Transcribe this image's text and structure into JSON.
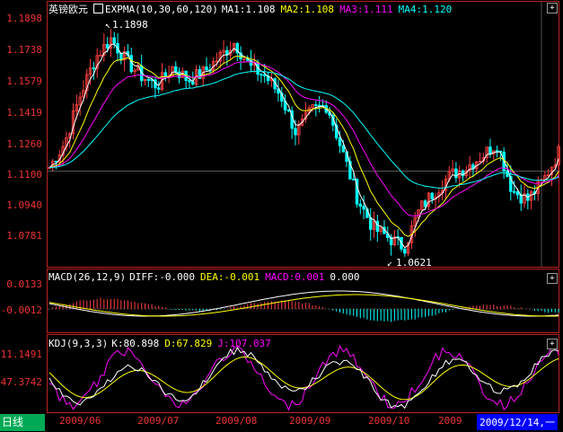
{
  "main": {
    "title": "英镑欧元",
    "indicator": "EXPMA(10,30,60,120)",
    "ma1": "MA1:1.108",
    "ma2": "MA2:1.108",
    "ma3": "MA3:1.111",
    "ma4": "MA4:1.120",
    "y_labels": [
      "1.1898",
      "1.1738",
      "1.1579",
      "1.1419",
      "1.1260",
      "1.1100",
      "1.0940",
      "1.0781"
    ],
    "high_label": "1.1898",
    "low_label": "1.0621"
  },
  "macd": {
    "title": "MACD(26,12,9)",
    "diff": "DIFF:-0.000",
    "dea": "DEA:-0.001",
    "macd": "MACD:0.001",
    "extra": "0.000",
    "y_labels": [
      "0.0133",
      "-0.0012"
    ]
  },
  "kdj": {
    "title": "KDJ(9,3,3)",
    "k": "K:80.898",
    "d": "D:67.829",
    "j": "J:107.037",
    "y_labels": [
      "11.1491",
      "47.3742"
    ]
  },
  "footer": {
    "period": "日线",
    "x_labels": [
      "2009/06",
      "2009/07",
      "2009/08",
      "2009/09",
      "2009/10",
      "2009"
    ],
    "current_date": "2009/12/14,一"
  },
  "buttons": {
    "plus": "+"
  },
  "colors": {
    "up": "#ff4040",
    "down": "#00ffff",
    "ma1": "#ffffff",
    "ma2": "#ffff00",
    "ma3": "#ff00ff",
    "ma4": "#00ffff",
    "axis": "#b22222"
  },
  "chart_data": [
    {
      "type": "candlestick",
      "title": "英镑欧元",
      "ylim": [
        1.0621,
        1.1898
      ],
      "x_ticks": [
        "2009/06",
        "2009/07",
        "2009/08",
        "2009/09",
        "2009/10",
        "2009"
      ],
      "high": 1.1898,
      "low": 1.0621,
      "close_samples": [
        1.112,
        1.125,
        1.15,
        1.17,
        1.18,
        1.168,
        1.16,
        1.155,
        1.165,
        1.158,
        1.162,
        1.17,
        1.178,
        1.165,
        1.16,
        1.15,
        1.13,
        1.142,
        1.145,
        1.12,
        1.095,
        1.08,
        1.075,
        1.07,
        1.09,
        1.1,
        1.108,
        1.112,
        1.118,
        1.125,
        1.1,
        1.095,
        1.105,
        1.12
      ]
    },
    {
      "type": "bar",
      "title": "MACD(26,12,9)",
      "series": [
        {
          "name": "DIFF",
          "value": -0.0
        },
        {
          "name": "DEA",
          "value": -0.001
        },
        {
          "name": "MACD",
          "value": 0.001
        }
      ]
    },
    {
      "type": "line",
      "title": "KDJ(9,3,3)",
      "series": [
        {
          "name": "K",
          "value": 80.898
        },
        {
          "name": "D",
          "value": 67.829
        },
        {
          "name": "J",
          "value": 107.037
        }
      ]
    }
  ]
}
